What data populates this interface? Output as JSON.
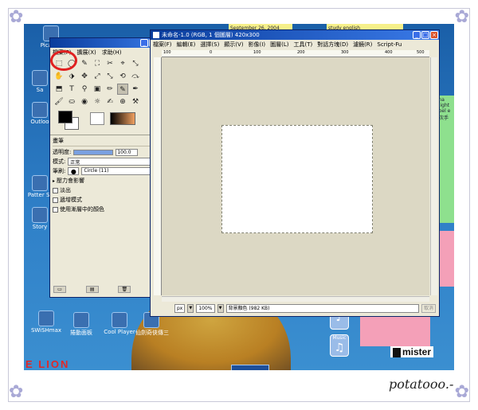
{
  "desktop": {
    "icons": [
      {
        "label": "Picasa2"
      },
      {
        "label": "Sa"
      },
      {
        "label": "Outloo"
      },
      {
        "label": "Patter St"
      },
      {
        "label": "Story"
      },
      {
        "label": "SWiSHmax"
      },
      {
        "label": "捲動面板"
      },
      {
        "label": "Cool Player"
      },
      {
        "label": "仙劍奇俠傳三"
      }
    ],
    "notes": {
      "date_note": "September 26, 2004",
      "study_note": "study english",
      "green_note": "gina onight e bel e 一次手",
      "pink_note": "攝控特賣 柔峰多香"
    },
    "lion_text": "E LION",
    "mister_logo": "mister",
    "music_label": "Music"
  },
  "toolbox": {
    "menu": [
      "檔案(F)",
      "擴展(X)",
      "求助(H)"
    ],
    "tools": [
      "⬚",
      "◯",
      "✎",
      "⛶",
      "✂",
      "⌖",
      "⤡",
      "✋",
      "⬗",
      "✥",
      "⤢",
      "⤡",
      "⟲",
      "⤼",
      "⬒",
      "T",
      "⚲",
      "▣",
      "✏",
      "✎",
      "✒",
      "🖌",
      "⛀",
      "◉",
      "☼",
      "✍",
      "⊕",
      "⚒"
    ],
    "brush_panel": {
      "title": "畫筆",
      "opacity_label": "透明度:",
      "opacity_value": "100.0",
      "mode_label": "模式:",
      "mode_value": "正常",
      "brush_label": "筆刷:",
      "brush_name": "Circle (11)",
      "pressure_label": "壓力會影響",
      "options": [
        "淡出",
        "遞增模式",
        "使用漸層中的顏色"
      ]
    }
  },
  "image_window": {
    "title": "未命名-1.0 (RGB, 1 個圖層) 420x300",
    "menu": [
      "檔案(F)",
      "編輯(E)",
      "選擇(S)",
      "顯示(V)",
      "影像(I)",
      "圖層(L)",
      "工具(T)",
      "對話方塊(D)",
      "濾鏡(R)",
      "Script-Fu"
    ],
    "ruler_ticks": [
      "100",
      "0",
      "100",
      "200",
      "300",
      "400",
      "500"
    ],
    "status": {
      "unit": "px",
      "zoom": "100%",
      "message": "背景顏色 (982 KB)",
      "cancel": "取消"
    }
  },
  "signature": "potatooo.-"
}
